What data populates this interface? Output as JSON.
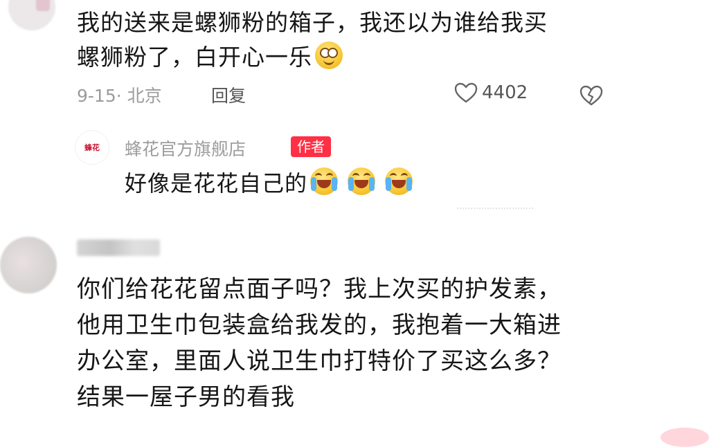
{
  "comment1": {
    "text_line1": "我的送来是螺狮粉的箱子，我还以为谁给我买",
    "text_line2": "螺狮粉了，白开心一乐",
    "date_location": "9-15· 北京",
    "reply_label": "回复",
    "like_count": "4402"
  },
  "reply": {
    "shop_logo_text": "蜂花",
    "shop_name": "蜂花官方旗舰店",
    "author_badge": "作者",
    "text": "好像是花花自己的"
  },
  "comment2": {
    "lines": [
      "你们给花花留点面子吗？我上次买的护发素，",
      "他用卫生巾包装盒给我发的，我抱着一大箱进",
      "办公室，里面人说卫生巾打特价了买这么多？",
      "结果一屋子男的看我"
    ]
  },
  "colors": {
    "badge": "#ff2f45",
    "muted_text": "#9b9b9b",
    "body_text": "#161616"
  }
}
